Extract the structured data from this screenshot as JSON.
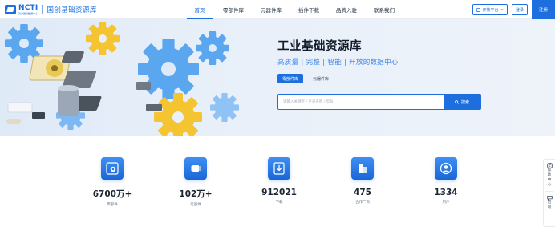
{
  "brand": {
    "logo_text": "NCTI",
    "logo_subtext": "天津国创数据中心",
    "name": "国创基础资源库"
  },
  "nav": {
    "items": [
      {
        "label": "首页",
        "active": true
      },
      {
        "label": "零部件库",
        "active": false
      },
      {
        "label": "元器件库",
        "active": false
      },
      {
        "label": "插件下载",
        "active": false
      },
      {
        "label": "品牌入驻",
        "active": false
      },
      {
        "label": "联系我们",
        "active": false
      }
    ]
  },
  "header_actions": {
    "open_platform": "开放平台",
    "login": "登录",
    "register": "注册"
  },
  "hero": {
    "title": "工业基础资源库",
    "subtitle": "高质量 | 完整 | 智能 | 开放的数据中心",
    "tabs": [
      {
        "label": "零部件库",
        "active": true
      },
      {
        "label": "元器件库",
        "active": false
      }
    ],
    "search_placeholder": "请输入关键字 / 产品名称 / 型号",
    "search_button": "搜索"
  },
  "stats": [
    {
      "value": "6700万+",
      "label": "零部件",
      "icon": "gear-icon"
    },
    {
      "value": "102万+",
      "label": "元器件",
      "icon": "chip-icon"
    },
    {
      "value": "912021",
      "label": "下载",
      "icon": "download-icon"
    },
    {
      "value": "475",
      "label": "合作厂商",
      "icon": "building-icon"
    },
    {
      "value": "1334",
      "label": "用户",
      "icon": "user-icon"
    }
  ],
  "side_panel": {
    "help": "帮助中心",
    "contact": "咨询"
  },
  "colors": {
    "primary": "#1d6fe0",
    "hero_bg": "#e9f0f9",
    "gear_blue": "#5aa7f0",
    "gear_yellow": "#f5c431"
  }
}
